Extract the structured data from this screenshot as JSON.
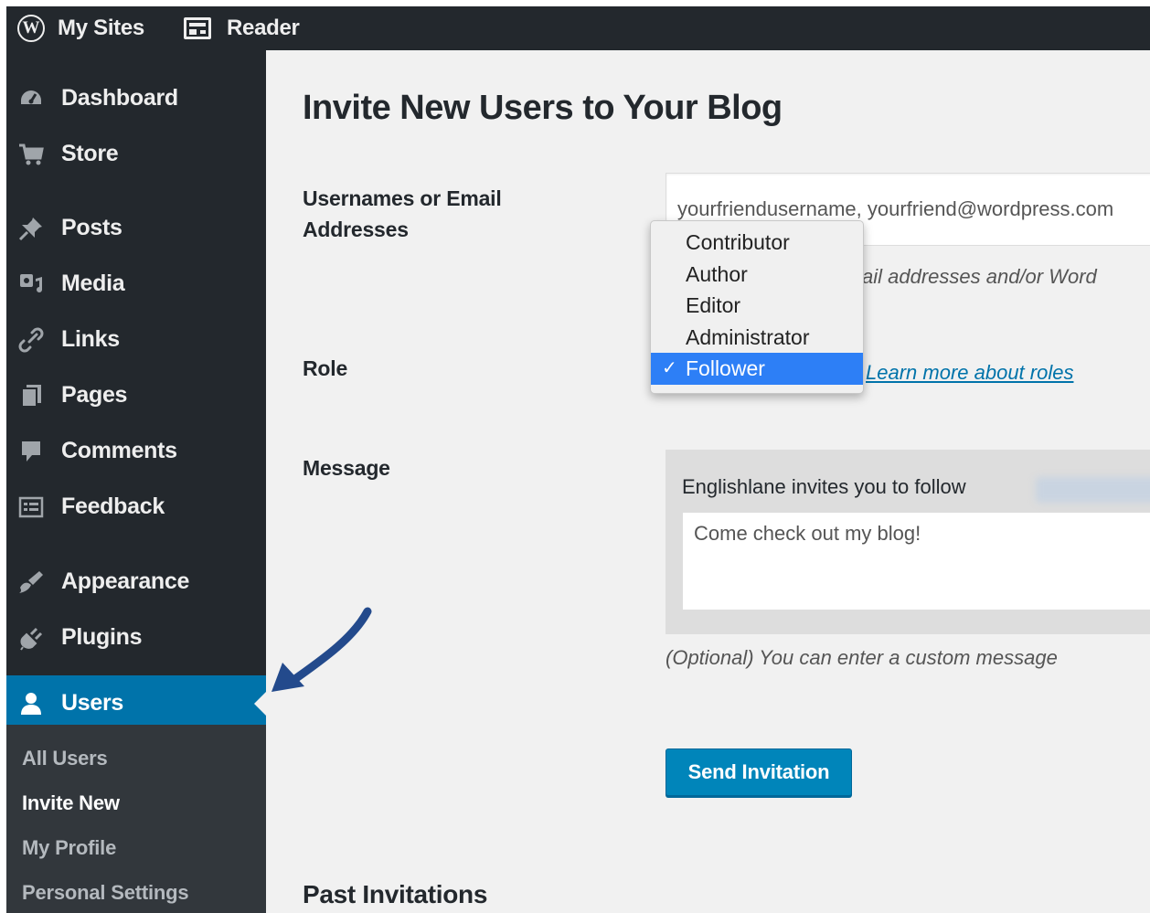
{
  "adminbar": {
    "my_sites": "My Sites",
    "reader": "Reader"
  },
  "sidebar": {
    "items": [
      {
        "label": "Dashboard",
        "icon": "dashboard-icon"
      },
      {
        "label": "Store",
        "icon": "cart-icon"
      },
      {
        "label": "Posts",
        "icon": "pin-icon"
      },
      {
        "label": "Media",
        "icon": "media-icon"
      },
      {
        "label": "Links",
        "icon": "link-icon"
      },
      {
        "label": "Pages",
        "icon": "pages-icon"
      },
      {
        "label": "Comments",
        "icon": "comment-icon"
      },
      {
        "label": "Feedback",
        "icon": "feedback-icon"
      },
      {
        "label": "Appearance",
        "icon": "brush-icon"
      },
      {
        "label": "Plugins",
        "icon": "plug-icon"
      },
      {
        "label": "Users",
        "icon": "user-icon"
      }
    ],
    "submenu": [
      "All Users",
      "Invite New",
      "My Profile",
      "Personal Settings"
    ],
    "active_item": "Users",
    "current_subitem": "Invite New"
  },
  "main": {
    "title": "Invite New Users to Your Blog",
    "usernames_label_line1": "Usernames or Email",
    "usernames_label_line2": "Addresses",
    "usernames_placeholder": "yourfriendusername, yourfriend@wordpress.com",
    "usernames_hint": "ail addresses and/or Word",
    "role_label": "Role",
    "role_options": [
      "Contributor",
      "Author",
      "Editor",
      "Administrator",
      "Follower"
    ],
    "role_selected": "Follower",
    "roles_link": "Learn more about roles",
    "message_label": "Message",
    "message_intro": "Englishlane invites you to follow",
    "message_text": "Come check out my blog!",
    "message_hint": "(Optional) You can enter a custom message",
    "send_button": "Send Invitation",
    "past_invitations": "Past Invitations"
  },
  "colors": {
    "sidebar_bg": "#23282d",
    "submenu_bg": "#32373c",
    "active_bg": "#0073aa",
    "button_bg": "#0085ba",
    "content_bg": "#f1f1f1",
    "dropdown_selected": "#2d7ff6",
    "arrow": "#234a8c"
  }
}
